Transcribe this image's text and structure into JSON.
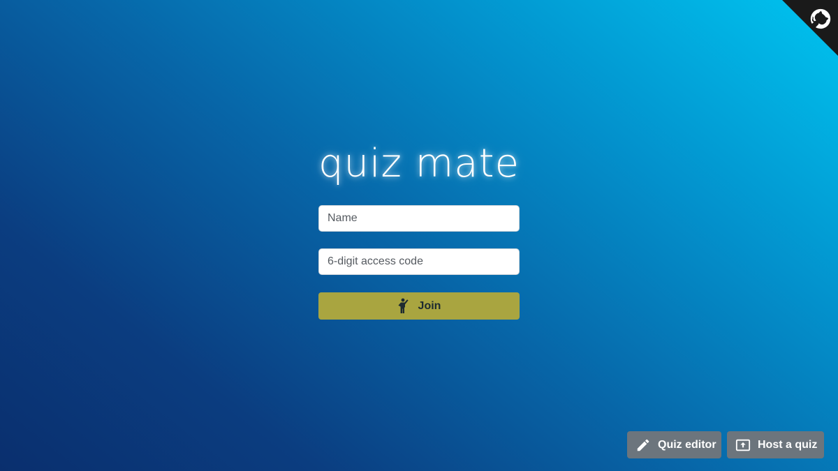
{
  "app": {
    "logo_text": "quiz mate"
  },
  "form": {
    "name_placeholder": "Name",
    "code_placeholder": "6-digit access code",
    "join_label": "Join",
    "join_icon": "person-waving-icon"
  },
  "footer": {
    "editor_label": "Quiz editor",
    "editor_icon": "pencil-icon",
    "host_label": "Host a quiz",
    "host_icon": "present-upload-icon"
  },
  "corner": {
    "icon": "github-octocat-icon"
  },
  "colors": {
    "join_button": "#a9a540",
    "secondary_button": "#6c757d",
    "gradient_dark": "#0a2f6e",
    "gradient_light": "#00c4f0"
  }
}
